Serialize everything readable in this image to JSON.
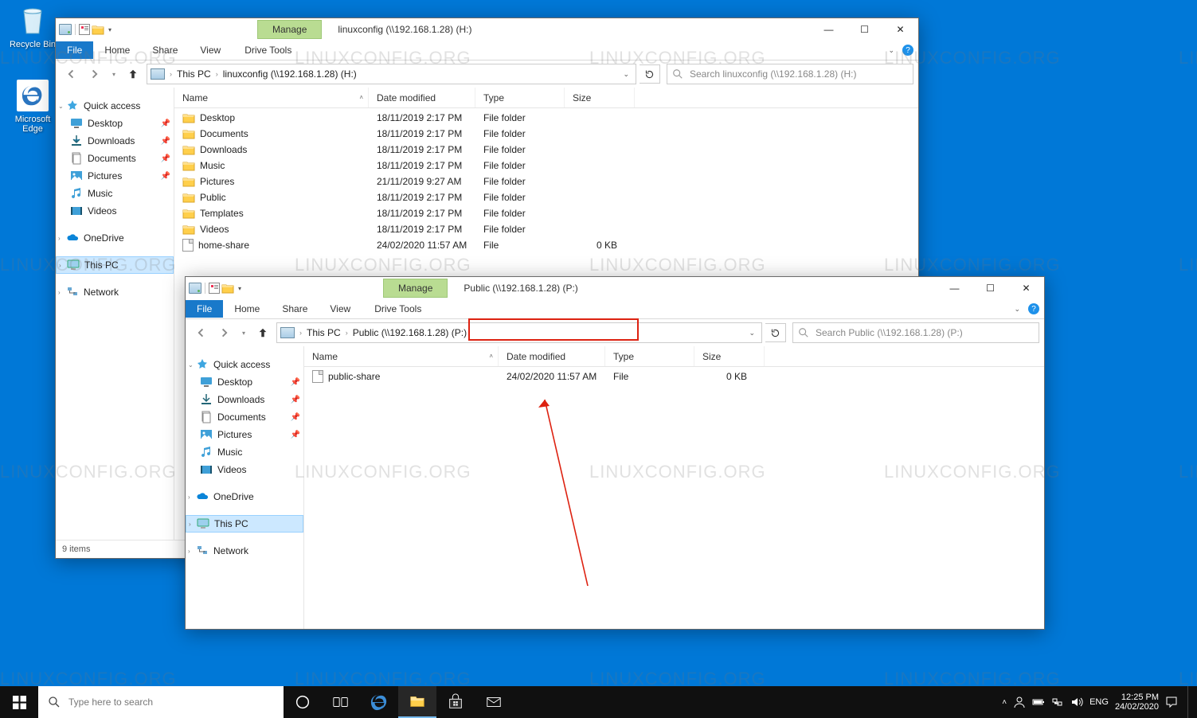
{
  "desktop": {
    "recycle": "Recycle Bin",
    "edge": "Microsoft Edge"
  },
  "win1": {
    "manage": "Manage",
    "title": "linuxconfig (\\\\192.168.1.28) (H:)",
    "tabs": {
      "file": "File",
      "home": "Home",
      "share": "Share",
      "view": "View",
      "drivetools": "Drive Tools"
    },
    "breadcrumb": {
      "pc": "This PC",
      "loc": "linuxconfig (\\\\192.168.1.28) (H:)"
    },
    "search_placeholder": "Search linuxconfig (\\\\192.168.1.28) (H:)",
    "cols": {
      "name": "Name",
      "date": "Date modified",
      "type": "Type",
      "size": "Size"
    },
    "nav": {
      "quick": "Quick access",
      "items": [
        {
          "label": "Desktop",
          "pin": true
        },
        {
          "label": "Downloads",
          "pin": true
        },
        {
          "label": "Documents",
          "pin": true
        },
        {
          "label": "Pictures",
          "pin": true
        },
        {
          "label": "Music",
          "pin": false
        },
        {
          "label": "Videos",
          "pin": false
        }
      ],
      "onedrive": "OneDrive",
      "thispc": "This PC",
      "network": "Network"
    },
    "rows": [
      {
        "name": "Desktop",
        "date": "18/11/2019 2:17 PM",
        "type": "File folder",
        "size": ""
      },
      {
        "name": "Documents",
        "date": "18/11/2019 2:17 PM",
        "type": "File folder",
        "size": ""
      },
      {
        "name": "Downloads",
        "date": "18/11/2019 2:17 PM",
        "type": "File folder",
        "size": ""
      },
      {
        "name": "Music",
        "date": "18/11/2019 2:17 PM",
        "type": "File folder",
        "size": ""
      },
      {
        "name": "Pictures",
        "date": "21/11/2019 9:27 AM",
        "type": "File folder",
        "size": ""
      },
      {
        "name": "Public",
        "date": "18/11/2019 2:17 PM",
        "type": "File folder",
        "size": ""
      },
      {
        "name": "Templates",
        "date": "18/11/2019 2:17 PM",
        "type": "File folder",
        "size": ""
      },
      {
        "name": "Videos",
        "date": "18/11/2019 2:17 PM",
        "type": "File folder",
        "size": ""
      },
      {
        "name": "home-share",
        "date": "24/02/2020 11:57 AM",
        "type": "File",
        "size": "0 KB",
        "file": true
      }
    ],
    "status": "9 items"
  },
  "win2": {
    "manage": "Manage",
    "title": "Public (\\\\192.168.1.28) (P:)",
    "tabs": {
      "file": "File",
      "home": "Home",
      "share": "Share",
      "view": "View",
      "drivetools": "Drive Tools"
    },
    "breadcrumb": {
      "pc": "This PC",
      "loc": "Public (\\\\192.168.1.28) (P:)"
    },
    "search_placeholder": "Search Public (\\\\192.168.1.28) (P:)",
    "cols": {
      "name": "Name",
      "date": "Date modified",
      "type": "Type",
      "size": "Size"
    },
    "nav": {
      "quick": "Quick access",
      "items": [
        {
          "label": "Desktop",
          "pin": true
        },
        {
          "label": "Downloads",
          "pin": true
        },
        {
          "label": "Documents",
          "pin": true
        },
        {
          "label": "Pictures",
          "pin": true
        },
        {
          "label": "Music",
          "pin": false
        },
        {
          "label": "Videos",
          "pin": false
        }
      ],
      "onedrive": "OneDrive",
      "thispc": "This PC",
      "network": "Network"
    },
    "rows": [
      {
        "name": "public-share",
        "date": "24/02/2020 11:57 AM",
        "type": "File",
        "size": "0 KB",
        "file": true
      }
    ]
  },
  "taskbar": {
    "search_placeholder": "Type here to search",
    "lang": "ENG",
    "time": "12:25 PM",
    "date": "24/02/2020"
  },
  "watermark": "LINUXCONFIG.ORG"
}
